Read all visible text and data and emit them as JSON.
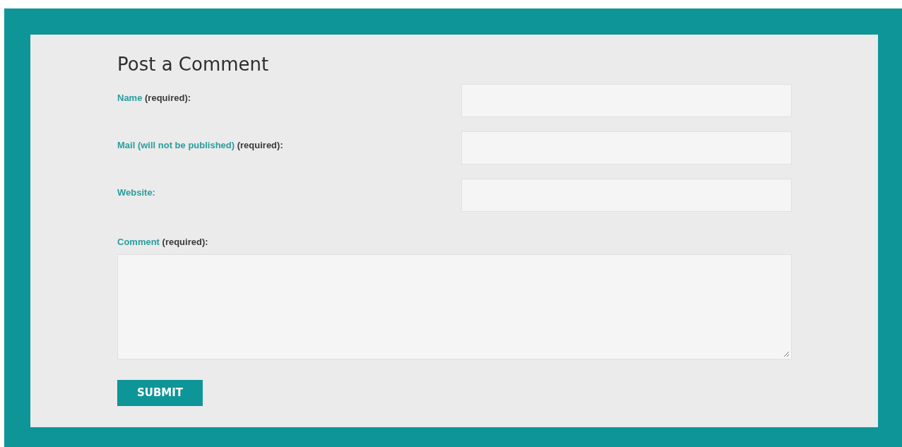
{
  "title": "Post a Comment",
  "fields": [
    {
      "kind": "input",
      "label": "Name",
      "note": "(required):"
    },
    {
      "kind": "input",
      "label": "Mail (will not be published)",
      "note": "(required):"
    },
    {
      "kind": "input",
      "label": "Website:"
    },
    {
      "kind": "textarea",
      "label": "Comment",
      "note": "(required):"
    }
  ],
  "submit": "SUBMIT"
}
